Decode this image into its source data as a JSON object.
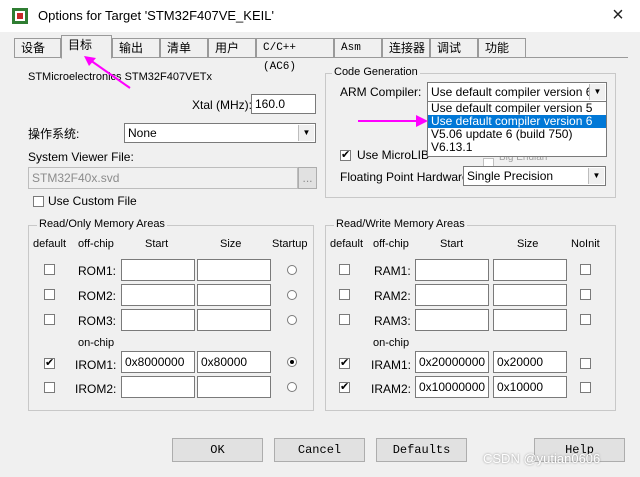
{
  "window": {
    "title": "Options for Target 'STM32F407VE_KEIL'",
    "close_glyph": "×"
  },
  "tabs": [
    {
      "label": "设备"
    },
    {
      "label": "目标"
    },
    {
      "label": "输出"
    },
    {
      "label": "清单"
    },
    {
      "label": "用户"
    },
    {
      "label": "C/C++ (AC6)"
    },
    {
      "label": "Asm"
    },
    {
      "label": "连接器"
    },
    {
      "label": "调试"
    },
    {
      "label": "功能"
    }
  ],
  "device": {
    "name": "STMicroelectronics STM32F407VETx",
    "xtal_label": "Xtal (MHz):",
    "xtal_value": "160.0",
    "os_label": "操作系统:",
    "os_value": "None",
    "svf_label": "System Viewer File:",
    "svf_value": "STM32F40x.svd",
    "browse_label": "...",
    "custom_file_label": "Use Custom File"
  },
  "codegen": {
    "title": "Code Generation",
    "arm_compiler_label": "ARM Compiler:",
    "arm_compiler_value": "Use default compiler version 6",
    "dropdown_options": [
      "Use default compiler version 5",
      "Use default compiler version 6",
      "V5.06 update 6 (build 750)",
      "V6.13.1"
    ],
    "microlib_label": "Use MicroLIB",
    "big_endian_label": "Big Endian",
    "fp_label": "Floating Point Hardware:",
    "fp_value": "Single Precision"
  },
  "ro_memory": {
    "title": "Read/Only Memory Areas",
    "headers": {
      "default": "default",
      "offchip": "off-chip",
      "start": "Start",
      "size": "Size",
      "startup": "Startup"
    },
    "onchip_label": "on-chip",
    "rows": [
      {
        "name": "ROM1:",
        "start": "",
        "size": ""
      },
      {
        "name": "ROM2:",
        "start": "",
        "size": ""
      },
      {
        "name": "ROM3:",
        "start": "",
        "size": ""
      },
      {
        "name": "IROM1:",
        "start": "0x8000000",
        "size": "0x80000"
      },
      {
        "name": "IROM2:",
        "start": "",
        "size": ""
      }
    ]
  },
  "rw_memory": {
    "title": "Read/Write Memory Areas",
    "headers": {
      "default": "default",
      "offchip": "off-chip",
      "start": "Start",
      "size": "Size",
      "noinit": "NoInit"
    },
    "onchip_label": "on-chip",
    "rows": [
      {
        "name": "RAM1:",
        "start": "",
        "size": ""
      },
      {
        "name": "RAM2:",
        "start": "",
        "size": ""
      },
      {
        "name": "RAM3:",
        "start": "",
        "size": ""
      },
      {
        "name": "IRAM1:",
        "start": "0x20000000",
        "size": "0x20000"
      },
      {
        "name": "IRAM2:",
        "start": "0x10000000",
        "size": "0x10000"
      }
    ]
  },
  "buttons": {
    "ok": "OK",
    "cancel": "Cancel",
    "defaults": "Defaults",
    "help": "Help"
  },
  "watermark": "CSDN @yutian0606",
  "colors": {
    "annotation_arrow": "#ff00ff",
    "selection": "#0078d7"
  }
}
